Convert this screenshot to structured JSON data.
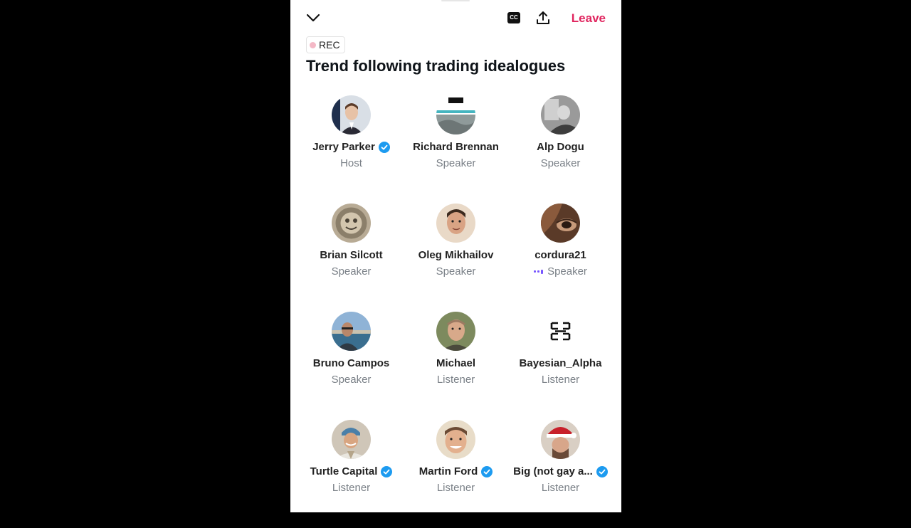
{
  "header": {
    "cc_label": "CC",
    "leave_label": "Leave"
  },
  "rec_label": "REC",
  "space_title": "Trend following trading idealogues",
  "participants": [
    {
      "name": "Jerry Parker",
      "role": "Host",
      "verified": true
    },
    {
      "name": "Richard Brennan",
      "role": "Speaker",
      "verified": false
    },
    {
      "name": "Alp Dogu",
      "role": "Speaker",
      "verified": false
    },
    {
      "name": "Brian Silcott",
      "role": "Speaker",
      "verified": false
    },
    {
      "name": "Oleg Mikhailov",
      "role": "Speaker",
      "verified": false
    },
    {
      "name": "cordura21",
      "role": "Speaker",
      "verified": false,
      "speaking": true
    },
    {
      "name": "Bruno Campos",
      "role": "Speaker",
      "verified": false
    },
    {
      "name": "Michael",
      "role": "Listener",
      "verified": false
    },
    {
      "name": "Bayesian_Alpha",
      "role": "Listener",
      "verified": false
    },
    {
      "name": "Turtle Capital",
      "role": "Listener",
      "verified": true
    },
    {
      "name": "Martin Ford",
      "role": "Listener",
      "verified": true
    },
    {
      "name": "Big (not gay a...",
      "role": "Listener",
      "verified": true
    }
  ],
  "colors": {
    "leave": "#e0245e",
    "verified": "#1d9bf0",
    "speaking_indicator": "#7856ff"
  }
}
